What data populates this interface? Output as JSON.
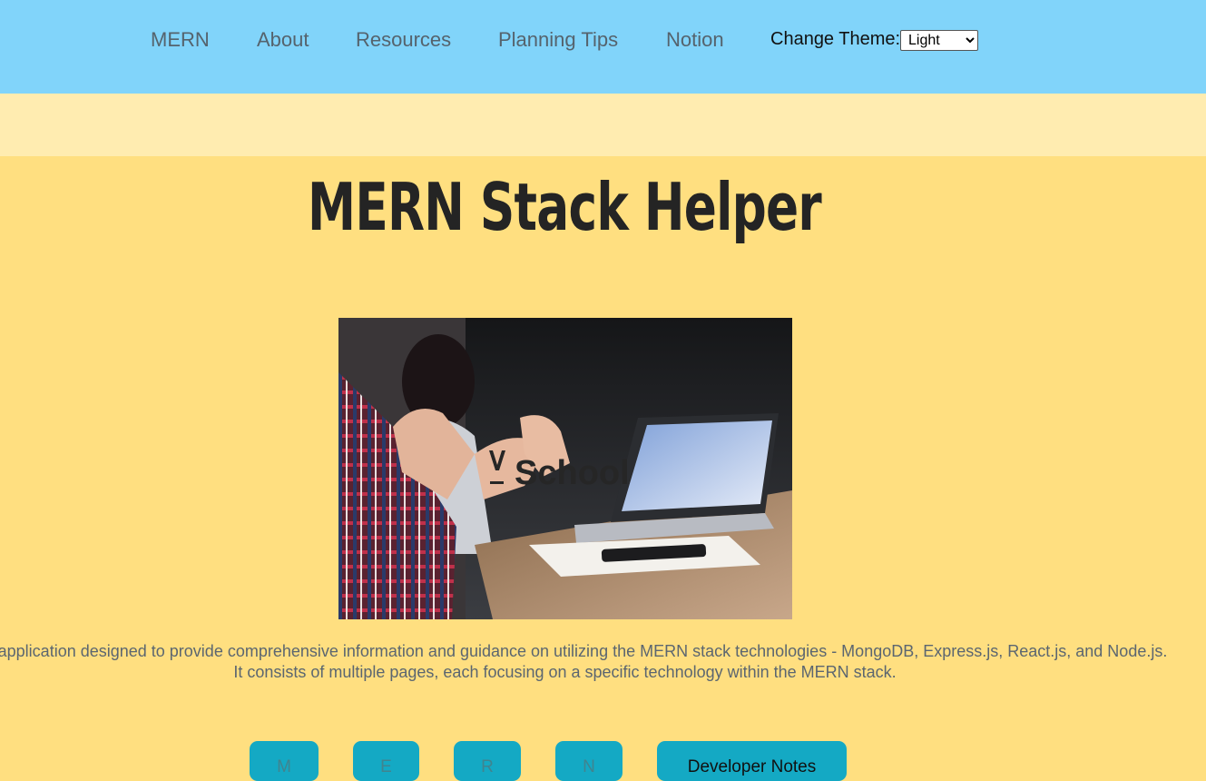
{
  "nav": {
    "links": [
      "MERN",
      "About",
      "Resources",
      "Planning Tips",
      "Notion"
    ],
    "theme_label": "Change Theme:",
    "theme_selected": "Light"
  },
  "main": {
    "title": "MERN Stack Helper",
    "hero_image": {
      "watermark_logo": "VSchool",
      "icon": "laptop-meeting-photo"
    },
    "description": {
      "line1": "This application designed to provide comprehensive information and guidance on utilizing the MERN stack technologies - MongoDB, Express.js, React.js, and Node.js.",
      "line2": "It consists of multiple pages, each focusing on a specific technology within the MERN stack."
    },
    "buttons": [
      "M",
      "E",
      "R",
      "N",
      "Developer Notes"
    ]
  },
  "colors": {
    "navbar": "#81d4fa",
    "page_background": "#ffdf80",
    "band": "#ffecb0",
    "button": "#14a9c4"
  }
}
